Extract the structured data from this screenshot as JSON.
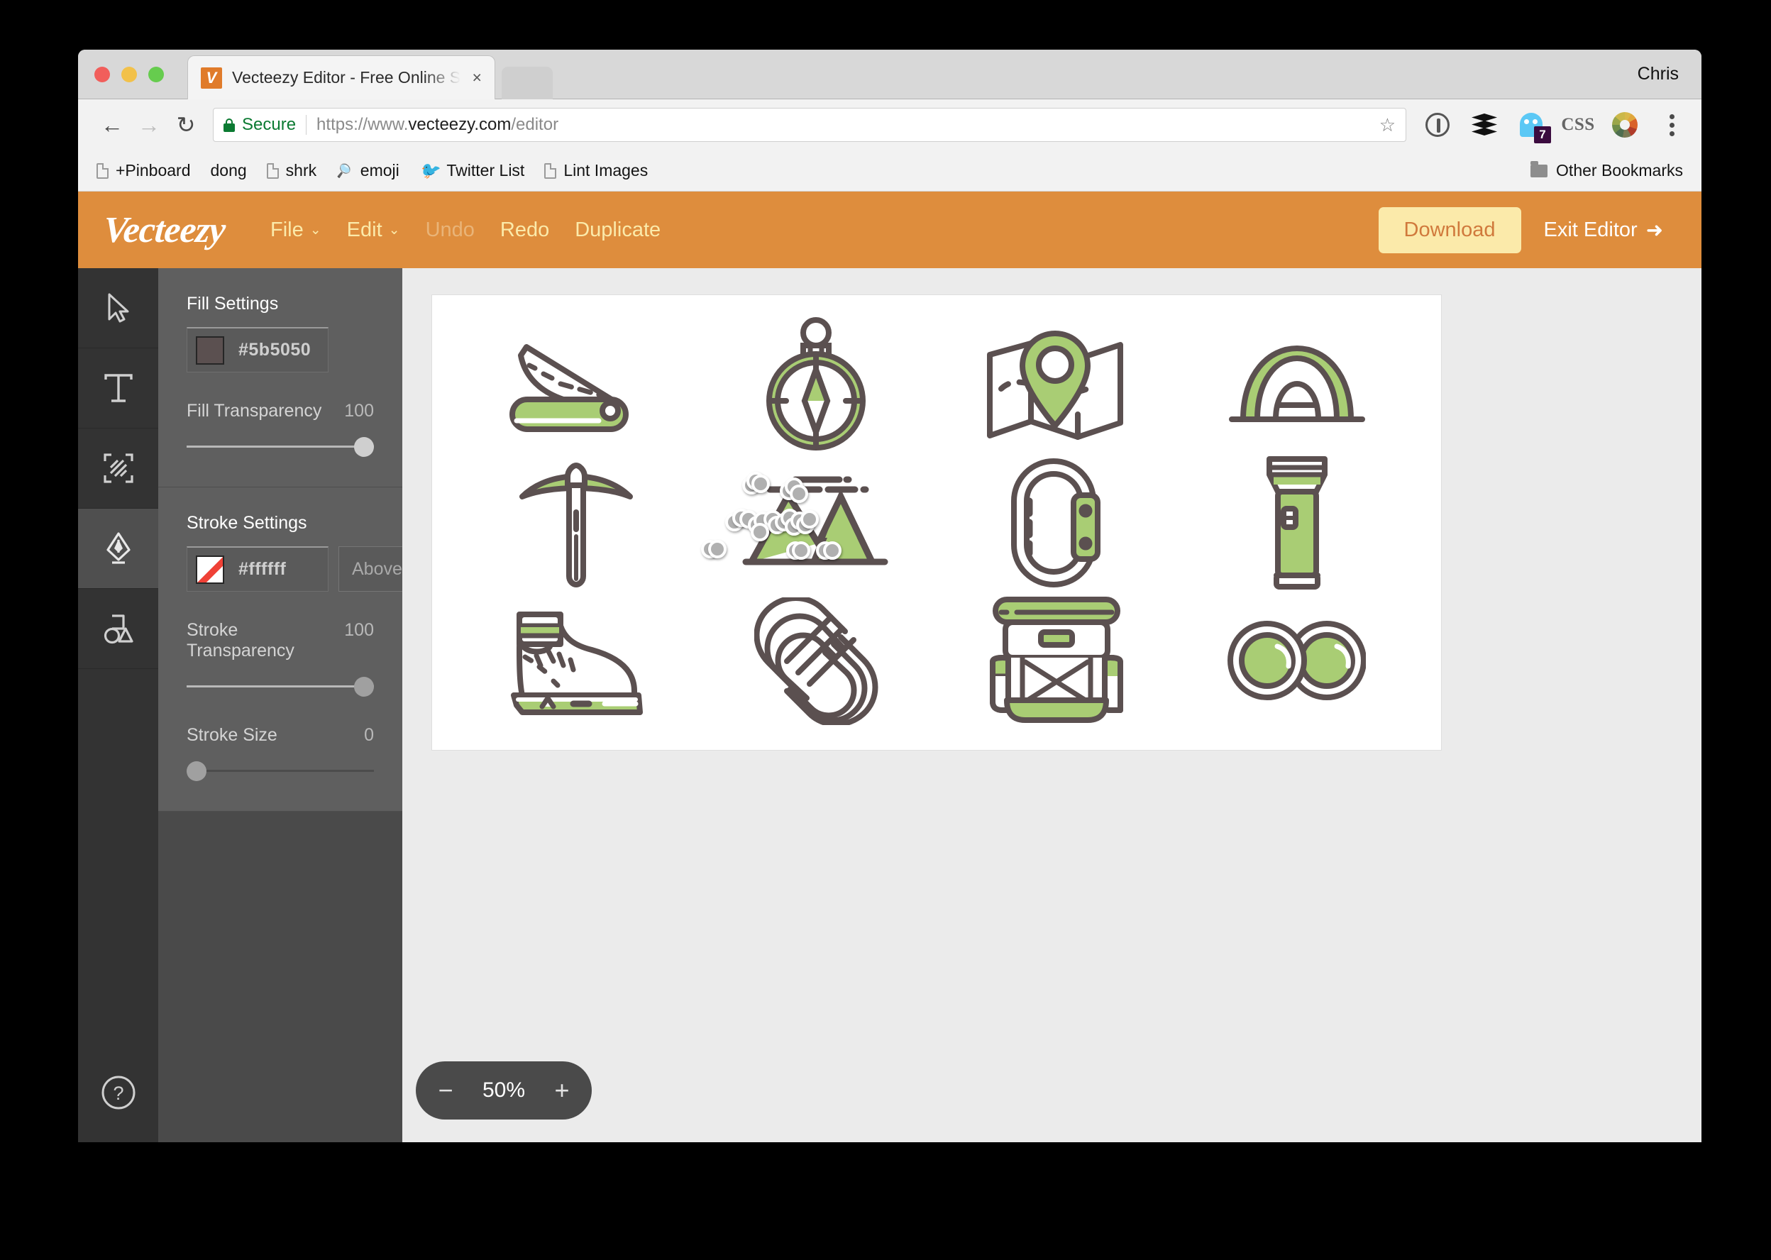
{
  "window": {
    "profile_name": "Chris",
    "traffic_lights": [
      "close",
      "minimize",
      "zoom"
    ]
  },
  "tab": {
    "title": "Vecteezy Editor - Free Online S",
    "favicon_letter": "V",
    "close_glyph": "×"
  },
  "toolbar": {
    "back_glyph": "←",
    "forward_glyph": "→",
    "reload_glyph": "↻",
    "secure_label": "Secure",
    "url_scheme": "https://www.",
    "url_domain": "vecteezy.com",
    "url_path": "/editor",
    "star_glyph": "☆",
    "extensions": [
      "1password-icon",
      "layers-icon",
      "ghostery-icon",
      "css-icon",
      "color-wheel-icon",
      "chrome-menu-icon"
    ],
    "ghostery_badge": "7",
    "css_label": "CSS"
  },
  "bookmarks": {
    "items": [
      {
        "label": "+Pinboard",
        "icon": "document-icon"
      },
      {
        "label": "dong",
        "icon": "none"
      },
      {
        "label": "shrk",
        "icon": "document-icon"
      },
      {
        "label": "emoji",
        "icon": "search-icon"
      },
      {
        "label": "Twitter List",
        "icon": "twitter-icon"
      },
      {
        "label": "Lint Images",
        "icon": "document-icon"
      }
    ],
    "other_label": "Other Bookmarks"
  },
  "app_header": {
    "logo": "Vecteezy",
    "menu": [
      {
        "label": "File",
        "has_caret": true,
        "disabled": false
      },
      {
        "label": "Edit",
        "has_caret": true,
        "disabled": false
      },
      {
        "label": "Undo",
        "has_caret": false,
        "disabled": true
      },
      {
        "label": "Redo",
        "has_caret": false,
        "disabled": false
      },
      {
        "label": "Duplicate",
        "has_caret": false,
        "disabled": false
      }
    ],
    "download_label": "Download",
    "exit_label": "Exit Editor",
    "exit_arrow": "➜",
    "caret_glyph": "⌄",
    "bg_color": "#de8d3d",
    "accent_color": "#fbeaaa"
  },
  "tools": [
    {
      "name": "select-tool",
      "active": false
    },
    {
      "name": "text-tool",
      "active": false
    },
    {
      "name": "transform-tool",
      "active": false
    },
    {
      "name": "pen-tool",
      "active": true
    },
    {
      "name": "shapes-tool",
      "active": false
    }
  ],
  "help_button": {
    "glyph": "?"
  },
  "fill_settings": {
    "title": "Fill Settings",
    "color_hex": "#5b5050",
    "swatch_color": "#5b5050",
    "transparency_label": "Fill Transparency",
    "transparency_value": "100",
    "transparency_pct": 100
  },
  "stroke_settings": {
    "title": "Stroke Settings",
    "color_hex": "#ffffff",
    "swatch_type": "none",
    "position_value": "Above",
    "position_caret": "▼",
    "transparency_label": "Stroke Transparency",
    "transparency_value": "100",
    "transparency_pct": 100,
    "size_label": "Stroke Size",
    "size_value": "0",
    "size_pct": 0
  },
  "canvas": {
    "zoom_level": "50%",
    "zoom_out_glyph": "−",
    "zoom_in_glyph": "+",
    "icon_stroke_color": "#5b5050",
    "icon_fill_color": "#a9cd74",
    "artboard_bg": "#ffffff",
    "icons": [
      {
        "name": "pocket-knife-icon",
        "row": 1,
        "col": 1
      },
      {
        "name": "compass-icon",
        "row": 1,
        "col": 2
      },
      {
        "name": "map-pin-icon",
        "row": 1,
        "col": 3
      },
      {
        "name": "tent-icon",
        "row": 1,
        "col": 4
      },
      {
        "name": "ice-axe-icon",
        "row": 2,
        "col": 1
      },
      {
        "name": "mountain-icon",
        "row": 2,
        "col": 2,
        "selected": true
      },
      {
        "name": "carabiner-icon",
        "row": 2,
        "col": 3
      },
      {
        "name": "flashlight-icon",
        "row": 2,
        "col": 4
      },
      {
        "name": "hiking-boot-icon",
        "row": 3,
        "col": 1
      },
      {
        "name": "rope-icon",
        "row": 3,
        "col": 2
      },
      {
        "name": "backpack-icon",
        "row": 3,
        "col": 3
      },
      {
        "name": "binoculars-icon",
        "row": 3,
        "col": 4
      }
    ]
  }
}
